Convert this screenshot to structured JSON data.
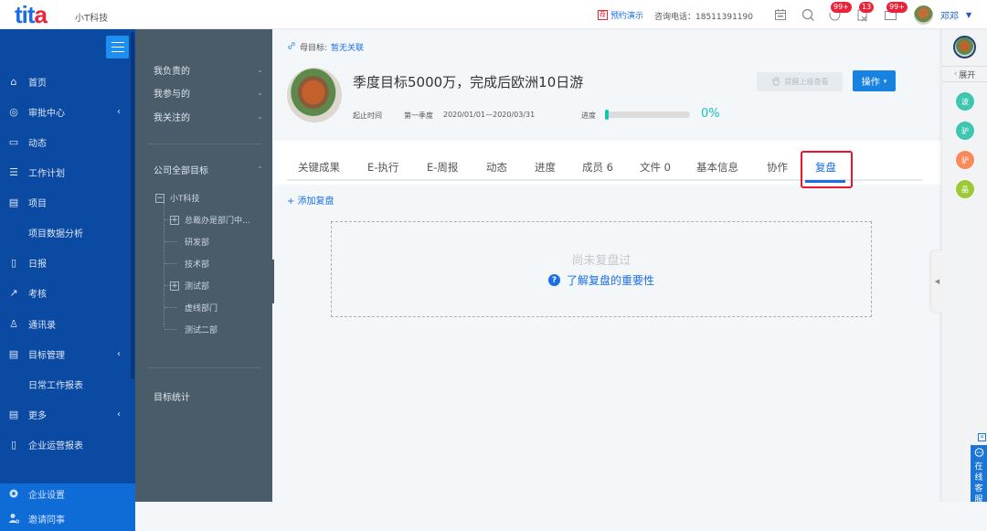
{
  "header": {
    "logo_left": "tit",
    "logo_right": "a",
    "company": "小T科技",
    "demo_tag": "荐",
    "demo_link": "预约演示",
    "phone": "咨询电话：18511391190",
    "icons": [
      {
        "name": "calendar-icon",
        "glyph": "▦",
        "badge": null
      },
      {
        "name": "search-icon",
        "glyph": "○",
        "badge": null
      },
      {
        "name": "message-icon",
        "glyph": "◡",
        "badge": "99+"
      },
      {
        "name": "task-icon",
        "glyph": "▤",
        "badge": "13"
      },
      {
        "name": "mail-icon",
        "glyph": "▭",
        "badge": "99+"
      }
    ],
    "user_name": "邓邓",
    "user_caret": "▼"
  },
  "nav": {
    "items": [
      {
        "label": "首页",
        "icon": "⌂",
        "icon_name": "home-icon",
        "arrow": ""
      },
      {
        "label": "审批中心",
        "icon": "◎",
        "icon_name": "approval-icon",
        "arrow": "‹"
      },
      {
        "label": "动态",
        "icon": "▭",
        "icon_name": "feed-icon",
        "arrow": ""
      },
      {
        "label": "工作计划",
        "icon": "☰",
        "icon_name": "plan-icon",
        "arrow": ""
      },
      {
        "label": "项目",
        "icon": "▤",
        "icon_name": "project-icon",
        "arrow": ""
      },
      {
        "label": "项目数据分析",
        "icon": "",
        "icon_name": "",
        "arrow": "",
        "sub": true
      },
      {
        "label": "日报",
        "icon": "▯",
        "icon_name": "daily-report-icon",
        "arrow": ""
      },
      {
        "label": "考核",
        "icon": "↗",
        "icon_name": "assessment-icon",
        "arrow": ""
      },
      {
        "label": "通讯录",
        "icon": "♙",
        "icon_name": "contacts-icon",
        "arrow": ""
      },
      {
        "label": "目标管理",
        "icon": "▤",
        "icon_name": "goal-icon",
        "arrow": "‹"
      },
      {
        "label": "日常工作报表",
        "icon": "",
        "icon_name": "",
        "arrow": "",
        "sub": true
      },
      {
        "label": "更多",
        "icon": "▤",
        "icon_name": "more-icon",
        "arrow": "‹"
      },
      {
        "label": "企业运营报表",
        "icon": "▯",
        "icon_name": "report-icon",
        "arrow": ""
      }
    ],
    "bottom": [
      {
        "label": "企业设置",
        "icon": "✿",
        "icon_name": "settings-icon"
      },
      {
        "label": "邀请同事",
        "icon": "♟",
        "icon_name": "invite-icon"
      }
    ]
  },
  "pane": {
    "groups": [
      {
        "label": "我负责的",
        "chev": "⌄"
      },
      {
        "label": "我参与的",
        "chev": "⌄"
      },
      {
        "label": "我关注的",
        "chev": "⌄"
      }
    ],
    "company_all": {
      "label": "公司全部目标",
      "chev": "⌃"
    },
    "tree": {
      "root": "小T科技",
      "children": [
        {
          "label": "总裁办是部门中...",
          "expandable": true
        },
        {
          "label": "研发部",
          "expandable": false
        },
        {
          "label": "技术部",
          "expandable": false
        },
        {
          "label": "测试部",
          "expandable": true
        },
        {
          "label": "虚线部门",
          "expandable": false
        },
        {
          "label": "测试二部",
          "expandable": false
        }
      ]
    },
    "stats": "目标统计"
  },
  "goal": {
    "parent_label": "母目标:",
    "parent_value": "暂无关联",
    "title": "季度目标5000万，完成后欧洲10日游",
    "period_label": "起止时间",
    "period_name": "第一季度",
    "period_range": "2020/01/01—2020/03/31",
    "progress_label": "进度",
    "progress_value": 0,
    "progress_text": "0%",
    "remind_button": "提醒上级查看",
    "action_button": "操作",
    "action_caret": "▾"
  },
  "tabs": [
    {
      "label": "关键成果",
      "active": false
    },
    {
      "label": "E-执行",
      "active": false
    },
    {
      "label": "E-周报",
      "active": false
    },
    {
      "label": "动态",
      "active": false
    },
    {
      "label": "进度",
      "active": false
    },
    {
      "label": "成员 6",
      "active": false
    },
    {
      "label": "文件 0",
      "active": false
    },
    {
      "label": "基本信息",
      "active": false
    },
    {
      "label": "协作",
      "active": false
    },
    {
      "label": "复盘",
      "active": true
    }
  ],
  "review": {
    "add_label": "+ 添加复盘",
    "empty_text": "尚未复盘过",
    "learn_link": "了解复盘的重要性"
  },
  "right_panel": {
    "expand_label": "展开",
    "members": [
      {
        "initial": "波",
        "color": "#3fc6b0"
      },
      {
        "initial": "驴",
        "color": "#3fc6b0"
      },
      {
        "initial": "驴",
        "color": "#fa8a5a"
      },
      {
        "initial": "晶",
        "color": "#9bc93a"
      }
    ]
  },
  "customer_service": {
    "close": "×",
    "chars": [
      "在",
      "线",
      "客",
      "服"
    ]
  }
}
